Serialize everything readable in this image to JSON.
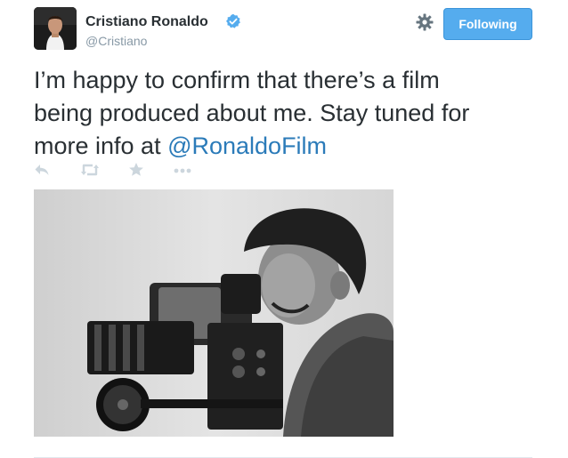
{
  "user": {
    "name": "Cristiano Ronaldo",
    "handle": "@Cristiano",
    "verified_icon": "verified-badge-icon"
  },
  "header": {
    "settings_icon": "gear-icon",
    "follow_label": "Following"
  },
  "tweet": {
    "text_line1": "I’m happy to confirm that there’s a film",
    "text_line2": "being produced about me. Stay tuned for",
    "text_line3_prefix": "more info at ",
    "mention": "@RonaldoFilm"
  },
  "actions": [
    "reply-icon",
    "retweet-icon",
    "favorite-icon",
    "more-icon"
  ],
  "colors": {
    "accent": "#55acee",
    "link": "#2b7bb9",
    "text": "#292f33",
    "muted": "#8899a6"
  }
}
